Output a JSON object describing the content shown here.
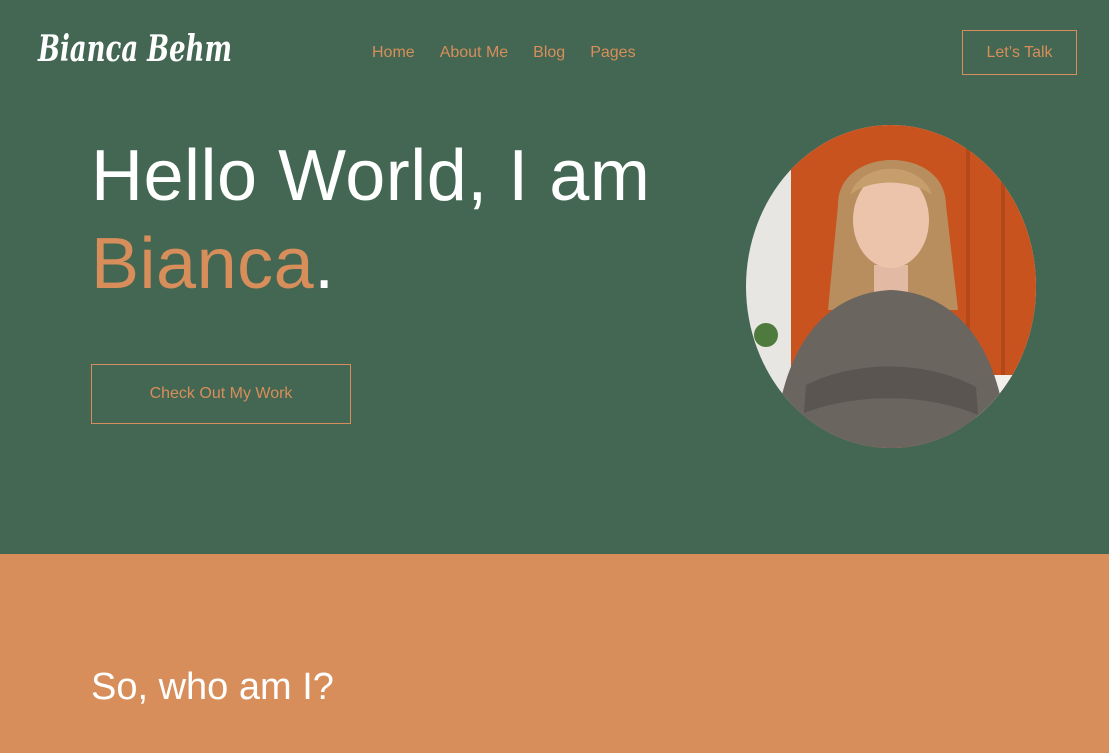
{
  "brand": {
    "name": "Bianca Behm"
  },
  "nav": {
    "items": [
      "Home",
      "About Me",
      "Blog",
      "Pages"
    ]
  },
  "header": {
    "cta_label": "Let’s Talk"
  },
  "hero": {
    "greeting": "Hello World, I am",
    "name": "Bianca",
    "punctuation": ".",
    "button_label": "Check Out My Work",
    "portrait_icon": "person-portrait-icon"
  },
  "about": {
    "heading": "So, who am I?"
  },
  "colors": {
    "hero_background": "#436752",
    "accent": "#d78e5a",
    "text_light": "#ffffff",
    "portrait_backdrop": "#c9531f"
  }
}
